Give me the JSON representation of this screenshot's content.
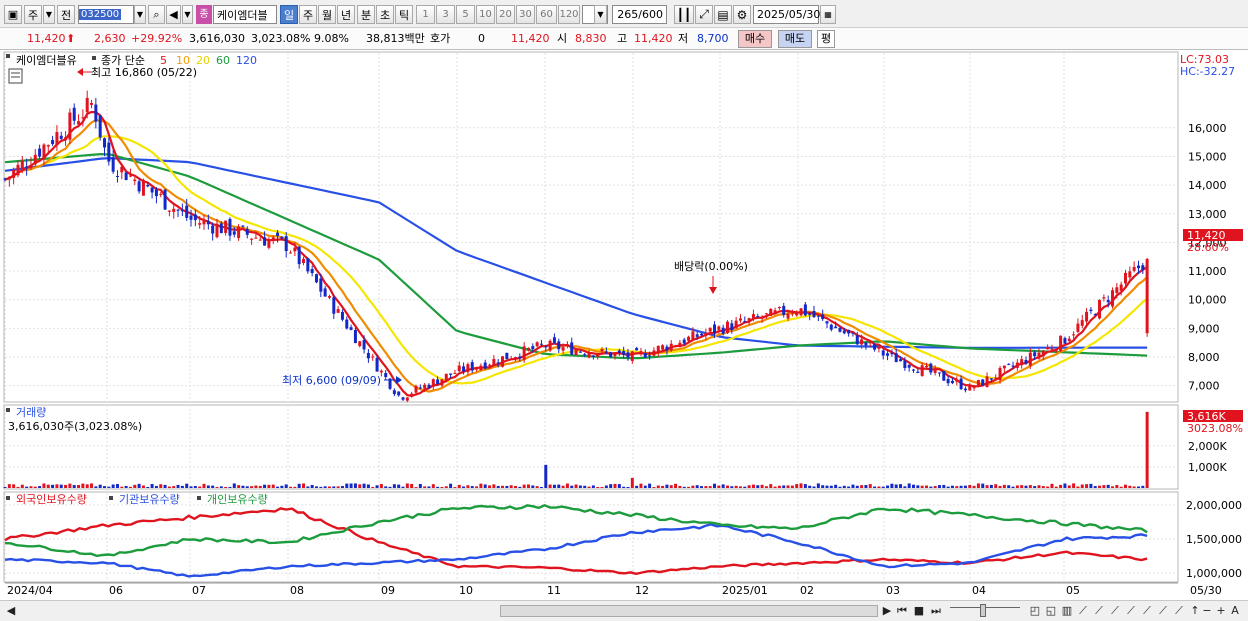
{
  "toolbar": {
    "market_type": "주",
    "prev_label": "전",
    "stock_code": "032500",
    "stock_name": "케이엠더블",
    "stock_badge": "종",
    "periods_main": [
      "일",
      "주",
      "월",
      "년",
      "분",
      "초",
      "틱"
    ],
    "selected_period": "일",
    "periods_num": [
      "1",
      "3",
      "5",
      "10",
      "20",
      "30",
      "60",
      "120"
    ],
    "count_value": "265",
    "count_max": "/600",
    "date_value": "2025/05/30"
  },
  "quote": {
    "price": "11,420",
    "change": "2,630",
    "change_pct": "+29.92%",
    "volume": "3,616,030",
    "vol_pct": "3,023.08%",
    "turnover": "9.08%",
    "amount": "38,813백만",
    "hoga_label": "호가",
    "hoga_value": "0",
    "ask_price": "11,420",
    "open_label": "시",
    "open_value": "8,830",
    "high_label": "고",
    "high_value": "11,420",
    "low_label": "저",
    "low_value": "8,700",
    "buy_label": "매수",
    "sell_label": "매도",
    "eval_label": "평"
  },
  "chart_data": [
    {
      "type": "candlestick",
      "title": "케이엠더블유",
      "legend": {
        "label": "종가 단순",
        "periods": [
          "5",
          "10",
          "20",
          "60",
          "120"
        ]
      },
      "colors": {
        "ma5": "#e0141e",
        "ma10": "#f08c00",
        "ma20": "#f5e600",
        "ma60": "#1c9c3c",
        "ma120": "#2850e6",
        "up": "#e0141e",
        "down": "#1428c8"
      },
      "y_axis_ticks": [
        "16,000",
        "15,000",
        "14,000",
        "13,000",
        "12,000",
        "11,000",
        "10,000",
        "9,000",
        "8,000",
        "7,000"
      ],
      "ylim": [
        6500,
        16900
      ],
      "lc_label": "LC:73.03",
      "hc_label": "HC:-32.27",
      "last_price": "11,420",
      "last_pct": "28.60%",
      "annotations": {
        "high": "최고 16,860 (05/22)",
        "low": "최저 6,600 (09/09)",
        "dividend": "배당락(0.00%)"
      },
      "x_axis_labels": [
        "2024/04",
        "06",
        "07",
        "08",
        "09",
        "10",
        "11",
        "12",
        "2025/01",
        "02",
        "03",
        "04",
        "05",
        "05/30"
      ],
      "key_closes": {
        "x": [
          "2024/04",
          "2024/05/22",
          "2024/06",
          "2024/07",
          "2024/08",
          "2024/09/09",
          "2024/10",
          "2024/11",
          "2024/12",
          "2025/01",
          "2025/02",
          "2025/03",
          "2025/04",
          "2025/05",
          "2025/05/30"
        ],
        "close": [
          14200,
          16860,
          14900,
          12800,
          11900,
          6600,
          7500,
          8400,
          8000,
          9000,
          9700,
          8100,
          6900,
          8600,
          11420
        ]
      },
      "ma120_close": {
        "x": [
          "2024/04",
          "2024/06",
          "2024/07",
          "2024/09",
          "2024/10",
          "2024/12",
          "2025/01",
          "2025/02",
          "2025/04",
          "2025/05/30"
        ],
        "value": [
          14500,
          14950,
          14800,
          13400,
          11700,
          9500,
          8700,
          8400,
          8320,
          8330
        ]
      },
      "ma60_close": {
        "x": [
          "2024/04",
          "2024/06",
          "2024/07",
          "2024/09",
          "2024/10",
          "2024/11",
          "2024/12",
          "2025/01",
          "2025/02",
          "2025/03",
          "2025/04",
          "2025/05/30"
        ],
        "value": [
          14800,
          15100,
          14300,
          11400,
          8900,
          8100,
          7950,
          8150,
          8400,
          8550,
          8300,
          8050
        ]
      }
    },
    {
      "type": "bar",
      "title": "거래량",
      "volume_label": "3,616,030주(3,023.08%)",
      "y_axis_ticks": [
        "2,000K",
        "1,000K"
      ],
      "ylim": [
        0,
        3800
      ],
      "last_value_label": "3,616K",
      "last_pct": "3023.08%",
      "values_k": {
        "typical": 110,
        "spikes": {
          "2024/11": 1100,
          "2024/12": 480,
          "2025/05/30": 3616
        }
      }
    },
    {
      "type": "line",
      "legend": [
        "외국인보유수량",
        "기관보유수량",
        "개인보유수량"
      ],
      "colors": [
        "#e0141e",
        "#2850e6",
        "#1c9c3c"
      ],
      "y_axis_ticks": [
        "2,000,000",
        "1,500,000",
        "1,000,000"
      ],
      "ylim": [
        900000,
        2100000
      ],
      "series": [
        {
          "name": "외국인보유수량",
          "x": [
            "2024/04",
            "2024/06",
            "2024/08",
            "2024/09",
            "2024/10",
            "2024/11",
            "2024/12",
            "2025/01",
            "2025/03",
            "2025/04",
            "2025/05",
            "2025/05/30"
          ],
          "values": [
            1500000,
            1700000,
            1950000,
            1450000,
            1100000,
            1080000,
            1000000,
            1100000,
            1200000,
            1150000,
            1300000,
            1200000
          ]
        },
        {
          "name": "기관보유수량",
          "x": [
            "2024/04",
            "2024/06",
            "2024/07",
            "2024/08",
            "2024/10",
            "2024/11",
            "2024/12",
            "2025/01",
            "2025/02",
            "2025/03",
            "2025/04",
            "2025/05",
            "2025/05/30"
          ],
          "values": [
            1200000,
            1150000,
            950000,
            1100000,
            1200000,
            1350000,
            1600000,
            1700000,
            1450000,
            1100000,
            1150000,
            1500000,
            1550000
          ]
        },
        {
          "name": "개인보유수량",
          "x": [
            "2024/04",
            "2024/06",
            "2024/07",
            "2024/08",
            "2024/09",
            "2024/10",
            "2024/11",
            "2024/12",
            "2025/01",
            "2025/02",
            "2025/03",
            "2025/04",
            "2025/05/30"
          ],
          "values": [
            1450000,
            1250000,
            1500000,
            1450000,
            1750000,
            1950000,
            1980000,
            1850000,
            1700000,
            1650000,
            1950000,
            1850000,
            1620000
          ]
        }
      ]
    }
  ]
}
